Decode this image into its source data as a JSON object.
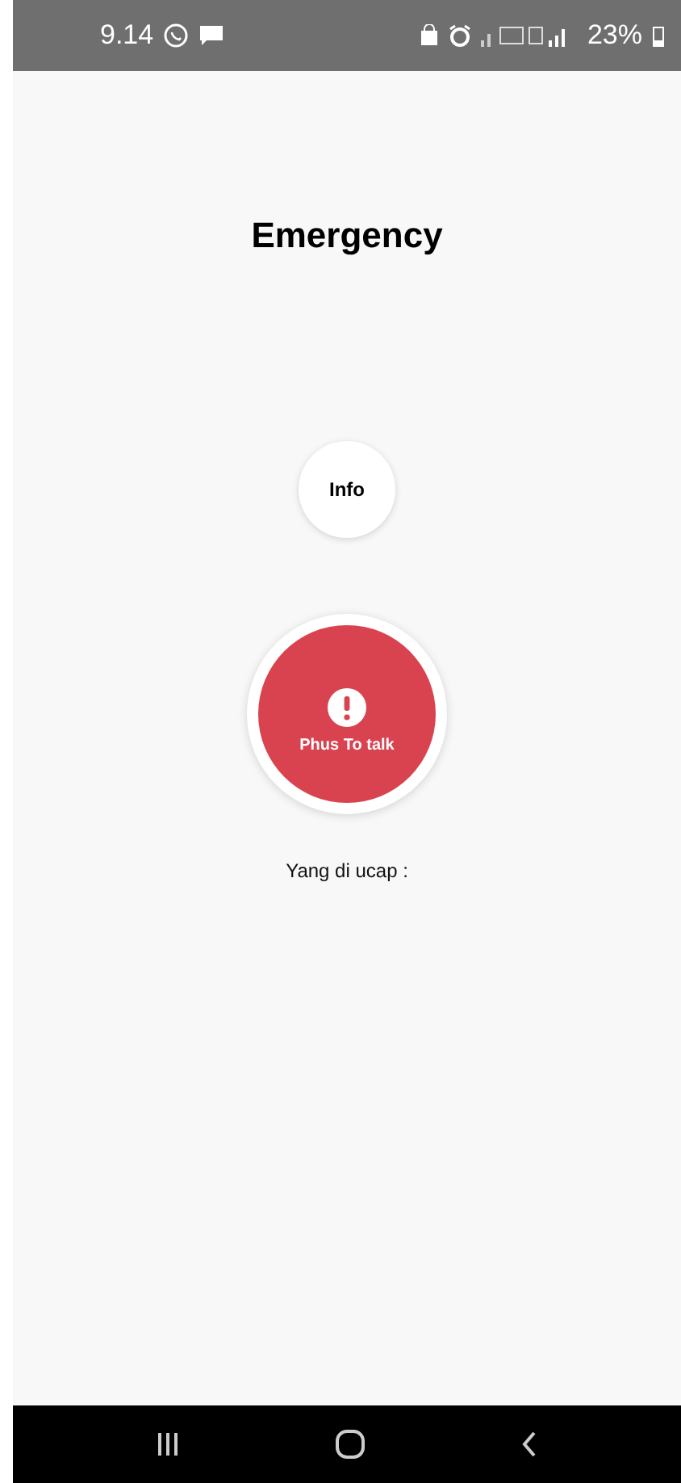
{
  "status_bar": {
    "time": "9.14",
    "battery": "23%"
  },
  "title": "Emergency",
  "info_button": {
    "label": "Info"
  },
  "talk_button": {
    "label": "Phus To talk"
  },
  "speech_label": "Yang di ucap :"
}
